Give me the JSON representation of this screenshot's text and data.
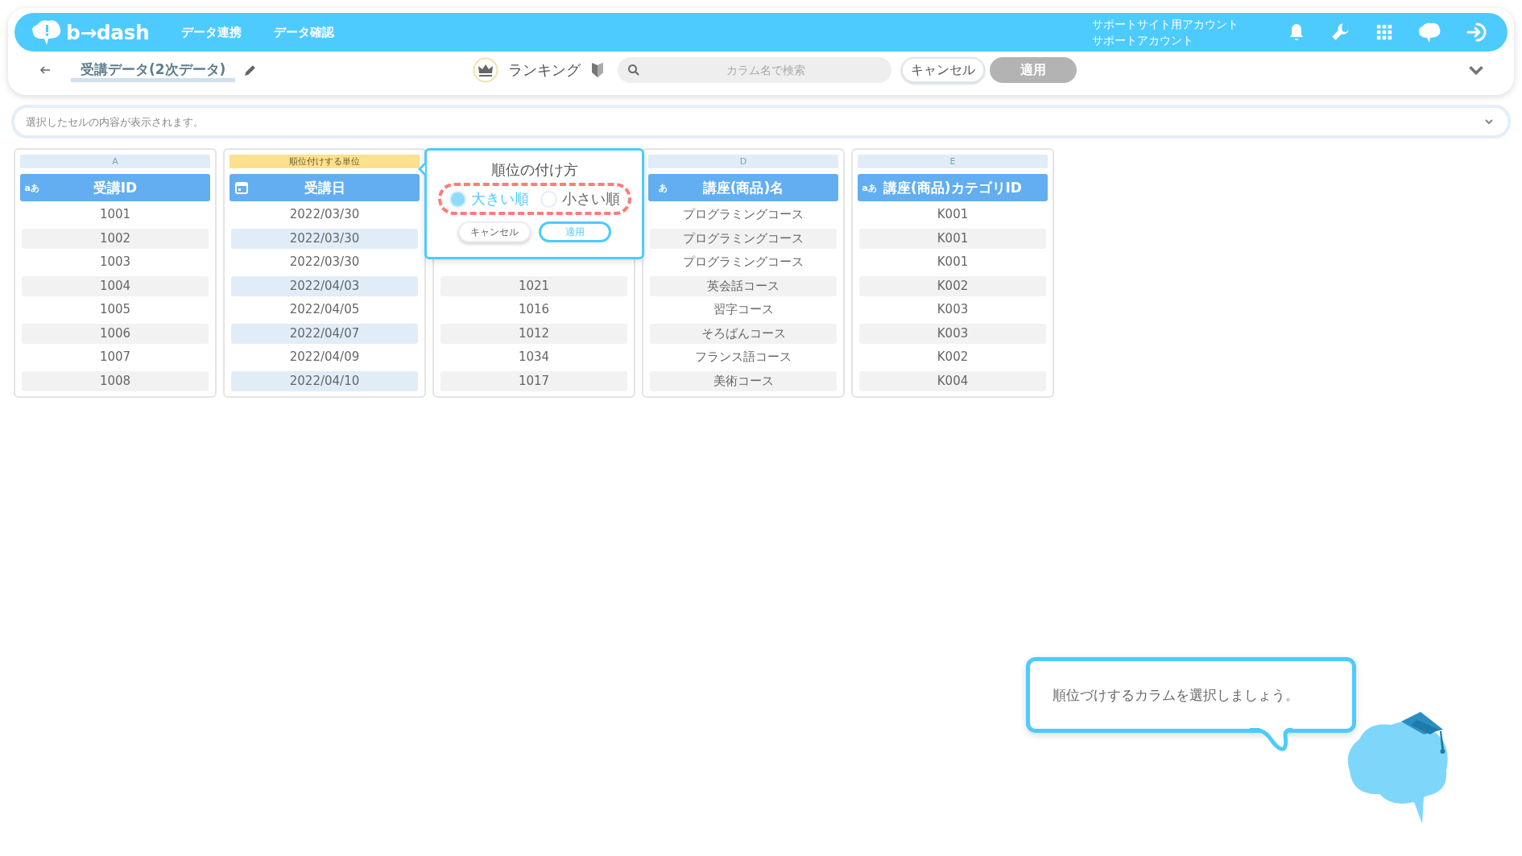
{
  "header": {
    "logo": "b→dash",
    "nav": [
      "データ連携",
      "データ確認"
    ],
    "account": [
      "サポートサイト用アカウント",
      "サポートアカウント"
    ]
  },
  "toolbar": {
    "title": "受講データ(2次データ)",
    "mode": "ランキング",
    "search": {
      "placeholder": "カラム名で検索"
    },
    "buttons": [
      {
        "label": "キャンセル",
        "disabled": false
      },
      {
        "label": "適用",
        "disabled": true
      }
    ]
  },
  "cell_bar": {
    "placeholder": "選択したセルの内容が表示されます。"
  },
  "columns": [
    {
      "letter": "A",
      "kind": "text",
      "type_label": "aあ",
      "name": "受講ID",
      "highlighted": false,
      "rows": [
        "1001",
        "1002",
        "1003",
        "1004",
        "1005",
        "1006",
        "1007",
        "1008"
      ]
    },
    {
      "tag": "順位付けする単位",
      "kind": "date",
      "name": "受講日",
      "highlighted": true,
      "rows": [
        "2022/03/30",
        "2022/03/30",
        "2022/03/30",
        "2022/04/03",
        "2022/04/05",
        "2022/04/07",
        "2022/04/09",
        "2022/04/10"
      ]
    },
    {
      "highlighted": false,
      "rows": [
        null,
        null,
        null,
        "1021",
        "1016",
        "1012",
        "1034",
        "1017"
      ]
    },
    {
      "letter": "D",
      "kind": "text",
      "type_label": "あ",
      "name": "講座(商品)名",
      "highlighted": false,
      "rows": [
        "プログラミングコース",
        "プログラミングコース",
        "プログラミングコース",
        "英会話コース",
        "習字コース",
        "そろばんコース",
        "フランス語コース",
        "美術コース"
      ]
    },
    {
      "letter": "E",
      "kind": "text",
      "type_label": "aあ",
      "name": "講座(商品)カテゴリID",
      "highlighted": false,
      "rows": [
        "K001",
        "K001",
        "K001",
        "K002",
        "K003",
        "K003",
        "K002",
        "K004"
      ]
    }
  ],
  "popup": {
    "title": "順位の付け方",
    "options": [
      {
        "label": "大きい順",
        "selected": true
      },
      {
        "label": "小さい順",
        "selected": false
      }
    ],
    "buttons": [
      "キャンセル",
      "適用"
    ]
  },
  "guide": {
    "message": "順位づけするカラムを選択しましょう。"
  }
}
